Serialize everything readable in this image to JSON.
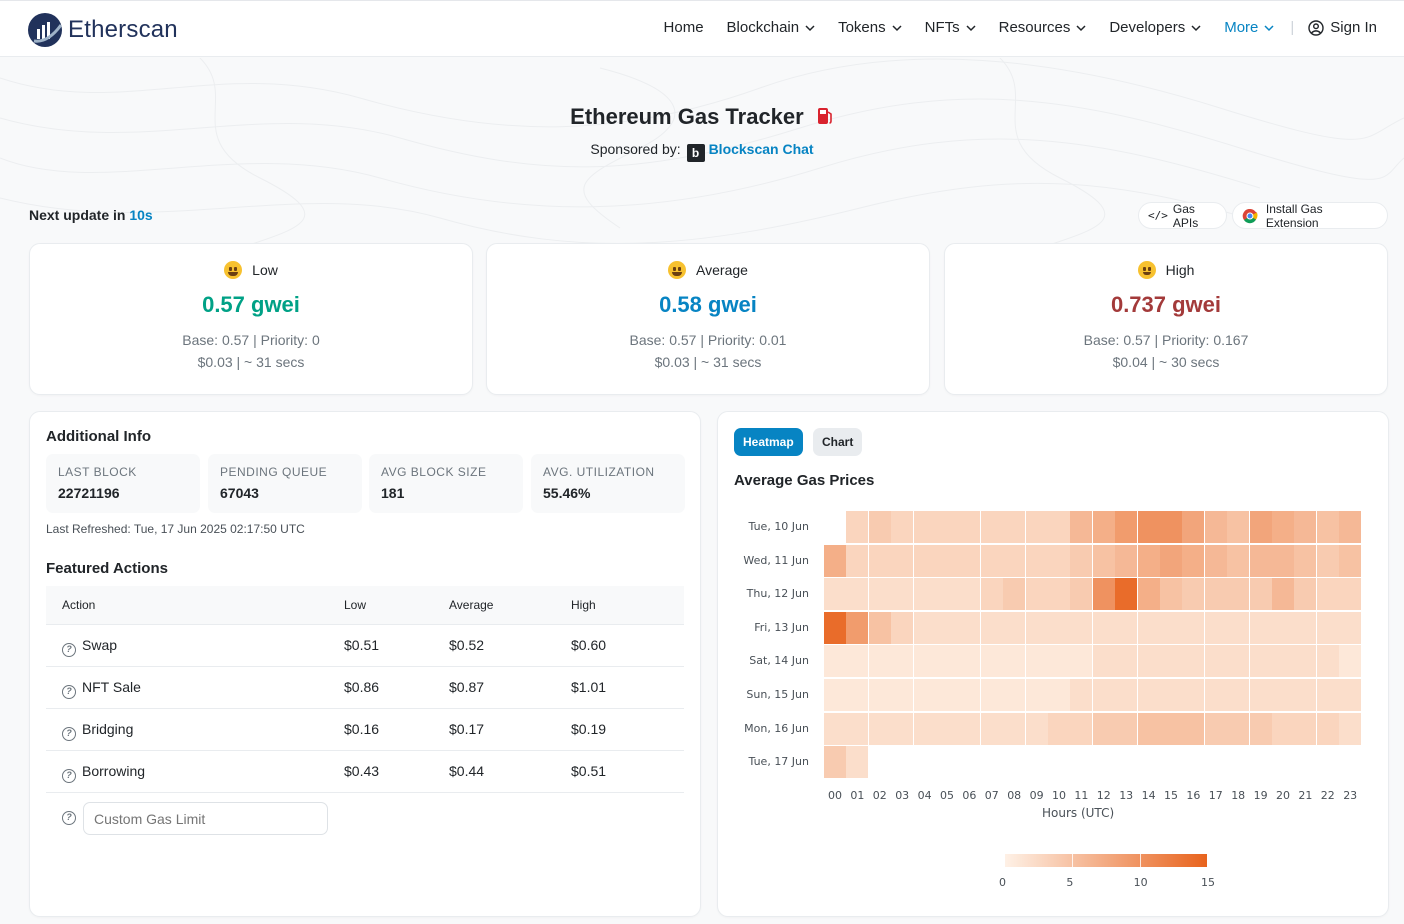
{
  "header": {
    "brand": "Etherscan",
    "nav": [
      "Home",
      "Blockchain",
      "Tokens",
      "NFTs",
      "Resources",
      "Developers"
    ],
    "more": "More",
    "sign_in": "Sign In"
  },
  "hero": {
    "title": "Ethereum Gas Tracker",
    "sponsored_prefix": "Sponsored by:",
    "sponsor_icon_letter": "b",
    "sponsor_name": "Blockscan Chat"
  },
  "update": {
    "prefix": "Next update in",
    "value": "10s"
  },
  "actions": {
    "gas_apis": "Gas APIs",
    "install_extension": "Install Gas Extension"
  },
  "gas": [
    {
      "label": "Low",
      "price": "0.57 gwei",
      "detail": "Base: 0.57 | Priority: 0",
      "cost": "$0.03 | ~ 31 secs",
      "color": "#00a186"
    },
    {
      "label": "Average",
      "price": "0.58 gwei",
      "detail": "Base: 0.57 | Priority: 0.01",
      "cost": "$0.03 | ~ 31 secs",
      "color": "#0784c3"
    },
    {
      "label": "High",
      "price": "0.737 gwei",
      "detail": "Base: 0.57 | Priority: 0.167",
      "cost": "$0.04 | ~ 30 secs",
      "color": "#a33a3a"
    }
  ],
  "additional": {
    "title": "Additional Info",
    "stats": [
      {
        "key": "LAST BLOCK",
        "value": "22721196"
      },
      {
        "key": "PENDING QUEUE",
        "value": "67043"
      },
      {
        "key": "AVG BLOCK SIZE",
        "value": "181"
      },
      {
        "key": "AVG. UTILIZATION",
        "value": "55.46%"
      }
    ],
    "refreshed": "Last Refreshed: Tue, 17 Jun 2025 02:17:50 UTC"
  },
  "featured": {
    "title": "Featured Actions",
    "columns": [
      "Action",
      "Low",
      "Average",
      "High"
    ],
    "rows": [
      {
        "action": "Swap",
        "low": "$0.51",
        "avg": "$0.52",
        "high": "$0.60"
      },
      {
        "action": "NFT Sale",
        "low": "$0.86",
        "avg": "$0.87",
        "high": "$1.01"
      },
      {
        "action": "Bridging",
        "low": "$0.16",
        "avg": "$0.17",
        "high": "$0.19"
      },
      {
        "action": "Borrowing",
        "low": "$0.43",
        "avg": "$0.44",
        "high": "$0.51"
      }
    ],
    "custom_placeholder": "Custom Gas Limit"
  },
  "heatmap_tabs": {
    "active": "Heatmap",
    "inactive": "Chart"
  },
  "chart_data": {
    "type": "heatmap",
    "title": "Average Gas Prices",
    "xlabel": "Hours (UTC)",
    "x": [
      "00",
      "01",
      "02",
      "03",
      "04",
      "05",
      "06",
      "07",
      "08",
      "09",
      "10",
      "11",
      "12",
      "13",
      "14",
      "15",
      "16",
      "17",
      "18",
      "19",
      "20",
      "21",
      "22",
      "23"
    ],
    "y": [
      "Tue, 10 Jun",
      "Wed, 11 Jun",
      "Thu, 12 Jun",
      "Fri, 13 Jun",
      "Sat, 14 Jun",
      "Sun, 15 Jun",
      "Mon, 16 Jun",
      "Tue, 17 Jun"
    ],
    "values": [
      [
        null,
        3,
        4,
        3,
        3,
        3,
        3,
        3,
        3,
        3,
        3,
        6,
        7,
        9,
        10,
        10,
        8,
        6,
        5,
        8,
        7,
        6,
        5,
        6
      ],
      [
        7,
        3,
        3,
        3,
        3,
        3,
        3,
        3,
        3,
        3,
        3,
        4,
        5,
        6,
        7,
        8,
        7,
        6,
        5,
        6,
        6,
        5,
        4,
        5
      ],
      [
        2,
        2,
        2,
        2,
        2,
        2,
        2,
        3,
        4,
        3,
        3,
        4,
        10,
        14,
        7,
        5,
        4,
        4,
        4,
        4,
        6,
        4,
        3,
        3
      ],
      [
        14,
        9,
        5,
        3,
        2,
        2,
        2,
        2,
        2,
        2,
        2,
        2,
        2,
        2,
        2,
        2,
        2,
        2,
        2,
        2,
        2,
        2,
        2,
        2
      ],
      [
        1,
        1,
        1,
        1,
        1,
        1,
        1,
        1,
        1,
        1,
        1,
        1,
        2,
        2,
        2,
        2,
        2,
        2,
        2,
        2,
        2,
        2,
        2,
        1
      ],
      [
        1,
        1,
        1,
        1,
        1,
        1,
        1,
        1,
        1,
        1,
        1,
        2,
        2,
        2,
        2,
        2,
        2,
        2,
        2,
        2,
        2,
        2,
        2,
        2
      ],
      [
        2,
        2,
        2,
        2,
        2,
        2,
        2,
        2,
        2,
        2,
        3,
        3,
        4,
        4,
        5,
        5,
        5,
        4,
        4,
        4,
        3,
        3,
        3,
        2
      ],
      [
        4,
        2,
        null,
        null,
        null,
        null,
        null,
        null,
        null,
        null,
        null,
        null,
        null,
        null,
        null,
        null,
        null,
        null,
        null,
        null,
        null,
        null,
        null,
        null
      ]
    ],
    "scale": {
      "min": 0,
      "max": 15,
      "ticks": [
        0,
        5,
        10,
        15
      ],
      "colors": [
        "#fef1e6",
        "#e8631d"
      ]
    }
  }
}
